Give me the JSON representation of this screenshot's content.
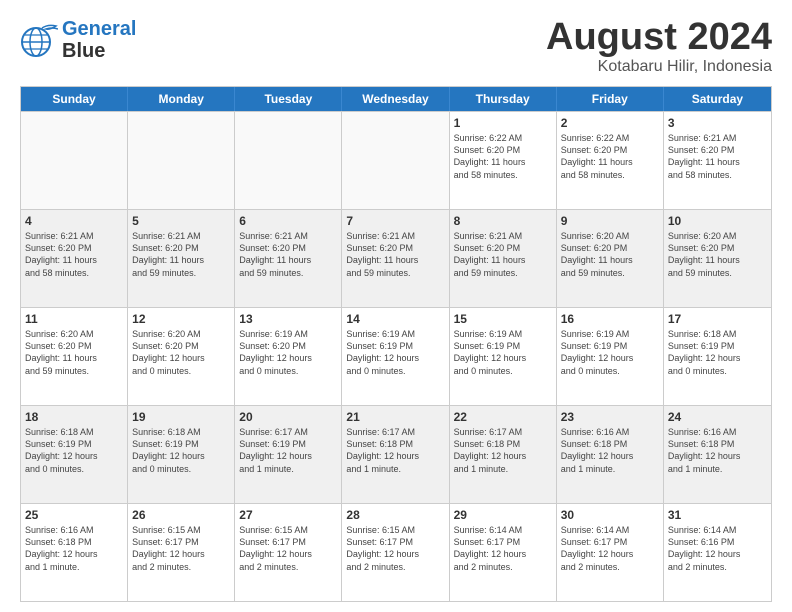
{
  "header": {
    "logo_line1": "General",
    "logo_line2": "Blue",
    "title": "August 2024",
    "subtitle": "Kotabaru Hilir, Indonesia"
  },
  "days": [
    "Sunday",
    "Monday",
    "Tuesday",
    "Wednesday",
    "Thursday",
    "Friday",
    "Saturday"
  ],
  "weeks": [
    [
      {
        "day": "",
        "detail": ""
      },
      {
        "day": "",
        "detail": ""
      },
      {
        "day": "",
        "detail": ""
      },
      {
        "day": "",
        "detail": ""
      },
      {
        "day": "1",
        "detail": "Sunrise: 6:22 AM\nSunset: 6:20 PM\nDaylight: 11 hours\nand 58 minutes."
      },
      {
        "day": "2",
        "detail": "Sunrise: 6:22 AM\nSunset: 6:20 PM\nDaylight: 11 hours\nand 58 minutes."
      },
      {
        "day": "3",
        "detail": "Sunrise: 6:21 AM\nSunset: 6:20 PM\nDaylight: 11 hours\nand 58 minutes."
      }
    ],
    [
      {
        "day": "4",
        "detail": "Sunrise: 6:21 AM\nSunset: 6:20 PM\nDaylight: 11 hours\nand 58 minutes."
      },
      {
        "day": "5",
        "detail": "Sunrise: 6:21 AM\nSunset: 6:20 PM\nDaylight: 11 hours\nand 59 minutes."
      },
      {
        "day": "6",
        "detail": "Sunrise: 6:21 AM\nSunset: 6:20 PM\nDaylight: 11 hours\nand 59 minutes."
      },
      {
        "day": "7",
        "detail": "Sunrise: 6:21 AM\nSunset: 6:20 PM\nDaylight: 11 hours\nand 59 minutes."
      },
      {
        "day": "8",
        "detail": "Sunrise: 6:21 AM\nSunset: 6:20 PM\nDaylight: 11 hours\nand 59 minutes."
      },
      {
        "day": "9",
        "detail": "Sunrise: 6:20 AM\nSunset: 6:20 PM\nDaylight: 11 hours\nand 59 minutes."
      },
      {
        "day": "10",
        "detail": "Sunrise: 6:20 AM\nSunset: 6:20 PM\nDaylight: 11 hours\nand 59 minutes."
      }
    ],
    [
      {
        "day": "11",
        "detail": "Sunrise: 6:20 AM\nSunset: 6:20 PM\nDaylight: 11 hours\nand 59 minutes."
      },
      {
        "day": "12",
        "detail": "Sunrise: 6:20 AM\nSunset: 6:20 PM\nDaylight: 12 hours\nand 0 minutes."
      },
      {
        "day": "13",
        "detail": "Sunrise: 6:19 AM\nSunset: 6:20 PM\nDaylight: 12 hours\nand 0 minutes."
      },
      {
        "day": "14",
        "detail": "Sunrise: 6:19 AM\nSunset: 6:19 PM\nDaylight: 12 hours\nand 0 minutes."
      },
      {
        "day": "15",
        "detail": "Sunrise: 6:19 AM\nSunset: 6:19 PM\nDaylight: 12 hours\nand 0 minutes."
      },
      {
        "day": "16",
        "detail": "Sunrise: 6:19 AM\nSunset: 6:19 PM\nDaylight: 12 hours\nand 0 minutes."
      },
      {
        "day": "17",
        "detail": "Sunrise: 6:18 AM\nSunset: 6:19 PM\nDaylight: 12 hours\nand 0 minutes."
      }
    ],
    [
      {
        "day": "18",
        "detail": "Sunrise: 6:18 AM\nSunset: 6:19 PM\nDaylight: 12 hours\nand 0 minutes."
      },
      {
        "day": "19",
        "detail": "Sunrise: 6:18 AM\nSunset: 6:19 PM\nDaylight: 12 hours\nand 0 minutes."
      },
      {
        "day": "20",
        "detail": "Sunrise: 6:17 AM\nSunset: 6:19 PM\nDaylight: 12 hours\nand 1 minute."
      },
      {
        "day": "21",
        "detail": "Sunrise: 6:17 AM\nSunset: 6:18 PM\nDaylight: 12 hours\nand 1 minute."
      },
      {
        "day": "22",
        "detail": "Sunrise: 6:17 AM\nSunset: 6:18 PM\nDaylight: 12 hours\nand 1 minute."
      },
      {
        "day": "23",
        "detail": "Sunrise: 6:16 AM\nSunset: 6:18 PM\nDaylight: 12 hours\nand 1 minute."
      },
      {
        "day": "24",
        "detail": "Sunrise: 6:16 AM\nSunset: 6:18 PM\nDaylight: 12 hours\nand 1 minute."
      }
    ],
    [
      {
        "day": "25",
        "detail": "Sunrise: 6:16 AM\nSunset: 6:18 PM\nDaylight: 12 hours\nand 1 minute."
      },
      {
        "day": "26",
        "detail": "Sunrise: 6:15 AM\nSunset: 6:17 PM\nDaylight: 12 hours\nand 2 minutes."
      },
      {
        "day": "27",
        "detail": "Sunrise: 6:15 AM\nSunset: 6:17 PM\nDaylight: 12 hours\nand 2 minutes."
      },
      {
        "day": "28",
        "detail": "Sunrise: 6:15 AM\nSunset: 6:17 PM\nDaylight: 12 hours\nand 2 minutes."
      },
      {
        "day": "29",
        "detail": "Sunrise: 6:14 AM\nSunset: 6:17 PM\nDaylight: 12 hours\nand 2 minutes."
      },
      {
        "day": "30",
        "detail": "Sunrise: 6:14 AM\nSunset: 6:17 PM\nDaylight: 12 hours\nand 2 minutes."
      },
      {
        "day": "31",
        "detail": "Sunrise: 6:14 AM\nSunset: 6:16 PM\nDaylight: 12 hours\nand 2 minutes."
      }
    ]
  ]
}
